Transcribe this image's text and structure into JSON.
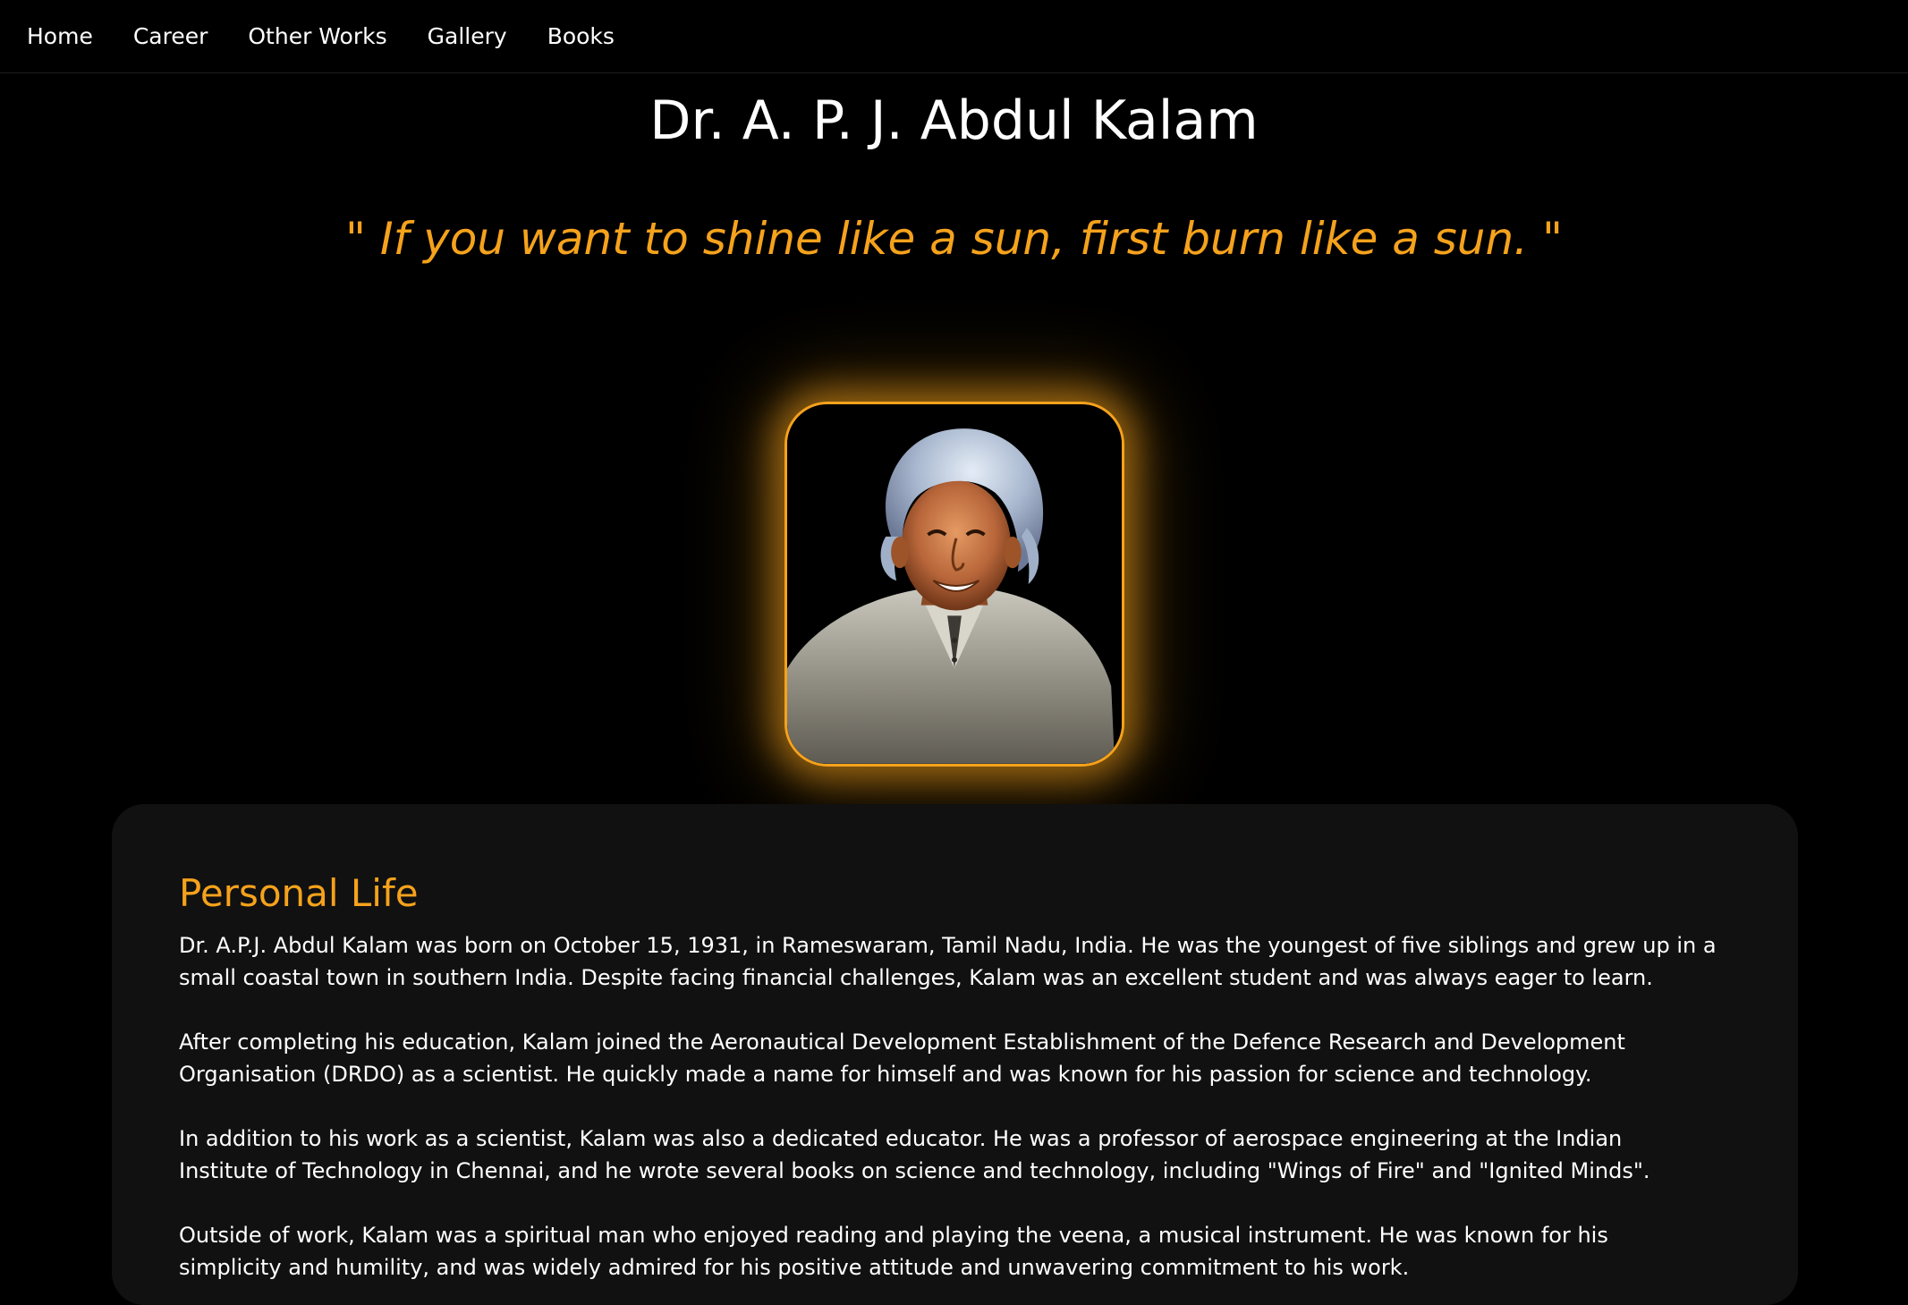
{
  "nav": {
    "items": [
      {
        "label": "Home"
      },
      {
        "label": "Career"
      },
      {
        "label": "Other Works"
      },
      {
        "label": "Gallery"
      },
      {
        "label": "Books"
      }
    ]
  },
  "header": {
    "title": "Dr. A. P. J. Abdul Kalam",
    "quote": "\" If you want to shine like a sun, first burn like a sun. \""
  },
  "portrait": {
    "icon": "portrait-image",
    "accent_color": "#f5a21c"
  },
  "personal_life": {
    "heading": "Personal Life",
    "paragraphs": [
      "Dr. A.P.J. Abdul Kalam was born on October 15, 1931, in Rameswaram, Tamil Nadu, India. He was the youngest of five siblings and grew up in a small coastal town in southern India. Despite facing financial challenges, Kalam was an excellent student and was always eager to learn.",
      "After completing his education, Kalam joined the Aeronautical Development Establishment of the Defence Research and Development Organisation (DRDO) as a scientist. He quickly made a name for himself and was known for his passion for science and technology.",
      "In addition to his work as a scientist, Kalam was also a dedicated educator. He was a professor of aerospace engineering at the Indian Institute of Technology in Chennai, and he wrote several books on science and technology, including \"Wings of Fire\" and \"Ignited Minds\".",
      "Outside of work, Kalam was a spiritual man who enjoyed reading and playing the veena, a musical instrument. He was known for his simplicity and humility, and was widely admired for his positive attitude and unwavering commitment to his work."
    ]
  },
  "colors": {
    "background": "#000000",
    "accent": "#f5a21c",
    "card": "#111111",
    "text": "#ffffff"
  }
}
